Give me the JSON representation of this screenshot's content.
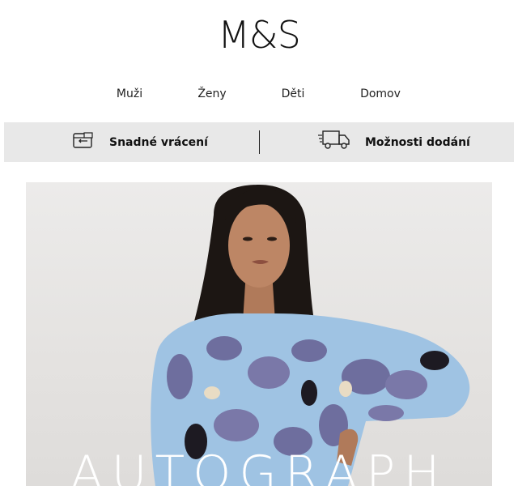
{
  "brand": {
    "logo": "M&S"
  },
  "nav": {
    "items": [
      {
        "label": "Muži"
      },
      {
        "label": "Ženy"
      },
      {
        "label": "Děti"
      },
      {
        "label": "Domov"
      }
    ]
  },
  "services": {
    "returns": {
      "label": "Snadné vrácení",
      "icon": "returns-box-icon"
    },
    "delivery": {
      "label": "Možnosti dodání",
      "icon": "delivery-truck-icon"
    }
  },
  "hero": {
    "headline": "AUTOGRAPH",
    "image": "woman-in-blue-floral-dress-photo"
  },
  "colors": {
    "service_bar": "#e8e8e8",
    "dress_blue": "#9fc3e3",
    "dress_purple": "#6e6e9e",
    "text": "#111111"
  }
}
